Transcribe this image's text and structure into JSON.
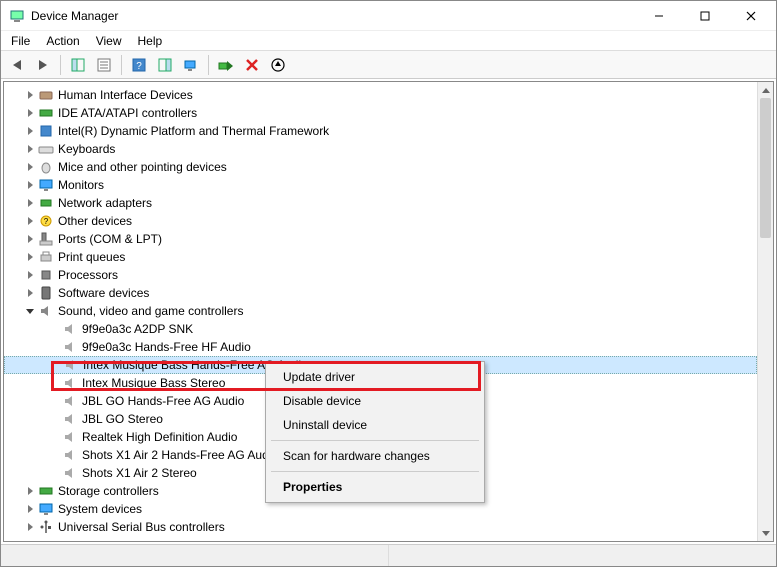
{
  "window": {
    "title": "Device Manager"
  },
  "menubar": {
    "file": "File",
    "action": "Action",
    "view": "View",
    "help": "Help"
  },
  "tree": {
    "hid": "Human Interface Devices",
    "ide": "IDE ATA/ATAPI controllers",
    "intel": "Intel(R) Dynamic Platform and Thermal Framework",
    "keyboards": "Keyboards",
    "mice": "Mice and other pointing devices",
    "monitors": "Monitors",
    "network": "Network adapters",
    "other": "Other devices",
    "ports": "Ports (COM & LPT)",
    "print": "Print queues",
    "processors": "Processors",
    "software": "Software devices",
    "sound": "Sound, video and game controllers",
    "sound_children": {
      "a2dp": "9f9e0a3c A2DP SNK",
      "hfhf": "9f9e0a3c Hands-Free HF Audio",
      "intex_hf": "Intex Musique Bass Hands-Free AG Audio",
      "intex_stereo": "Intex Musique Bass Stereo",
      "jbl_hf": "JBL GO Hands-Free AG Audio",
      "jbl_stereo": "JBL GO Stereo",
      "realtek": "Realtek High Definition Audio",
      "shots_hf": "Shots X1 Air 2 Hands-Free AG Audio",
      "shots_stereo": "Shots X1 Air 2 Stereo"
    },
    "storage": "Storage controllers",
    "system": "System devices",
    "usb": "Universal Serial Bus controllers"
  },
  "contextmenu": {
    "update": "Update driver",
    "disable": "Disable device",
    "uninstall": "Uninstall device",
    "scan": "Scan for hardware changes",
    "properties": "Properties"
  }
}
